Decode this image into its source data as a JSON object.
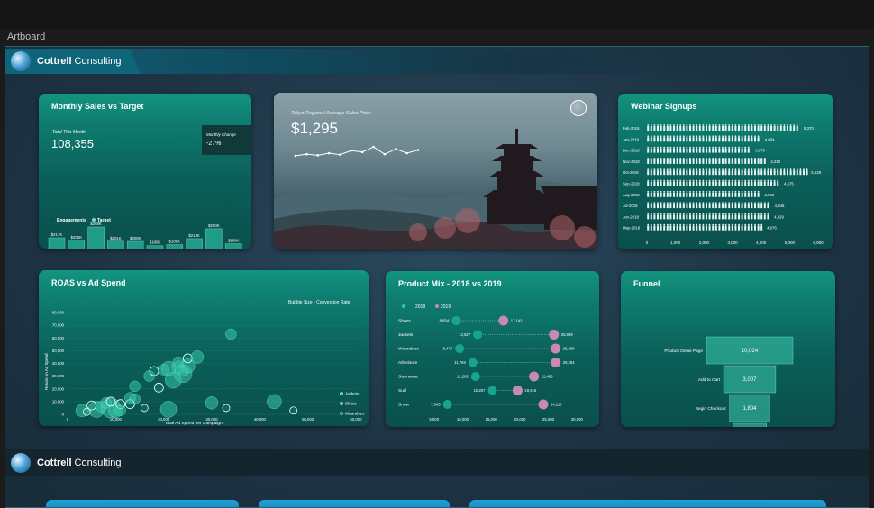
{
  "artboard_label": "Artboard",
  "brand": {
    "bold": "Cottrell",
    "rest": " Consulting"
  },
  "sales": {
    "title": "Monthly Sales vs Target",
    "total_label": "Total This Month",
    "total_value": "108,355",
    "change_label": "Monthly Change",
    "change_value": "-27%",
    "legend": [
      "Engagements",
      "Target"
    ],
    "months": [
      "May-2018",
      "Jun-2018",
      "Jul-2018",
      "Aug-2018",
      "Sep-2018",
      "Oct-2018",
      "Nov-2018",
      "Dec-2018",
      "Jan-2019",
      "Feb-2019"
    ],
    "targets": [
      "$217K",
      "$205K",
      "$268K",
      "$201K",
      "$200K",
      "$180K",
      "$185K",
      "$213K",
      "$260K",
      "$189K"
    ],
    "target_values": [
      217,
      205,
      268,
      201,
      200,
      180,
      185,
      213,
      260,
      189
    ],
    "engagements": [
      "$126K",
      "$108K",
      "$156K",
      "$122K",
      "$117K",
      "$103K",
      "$105K",
      "$124K",
      "$149K",
      "$108K"
    ],
    "engagement_values": [
      126,
      108,
      156,
      122,
      117,
      103,
      105,
      124,
      149,
      108
    ]
  },
  "photo": {
    "subtitle": "Tokyo Regional Average Sales Price",
    "value": "$1,295",
    "trend": [
      0.45,
      0.48,
      0.46,
      0.5,
      0.47,
      0.55,
      0.52,
      0.62,
      0.48,
      0.58,
      0.5,
      0.56
    ]
  },
  "webinar": {
    "title": "Webinar Signups",
    "rows": [
      {
        "m": "Feb-2019",
        "v": 5370,
        "l": "5,370"
      },
      {
        "m": "Jan-2019",
        "v": 4004,
        "l": "4,004"
      },
      {
        "m": "Dec-2018",
        "v": 3670,
        "l": "3,670"
      },
      {
        "m": "Nov-2018",
        "v": 4210,
        "l": "4,210"
      },
      {
        "m": "Oct-2018",
        "v": 5628,
        "l": "5,628"
      },
      {
        "m": "Sep-2018",
        "v": 4675,
        "l": "4,675"
      },
      {
        "m": "Aug-2018",
        "v": 3993,
        "l": "3,993"
      },
      {
        "m": "Jul-2018",
        "v": 4346,
        "l": "4,346"
      },
      {
        "m": "Jun-2018",
        "v": 4329,
        "l": "4,329"
      },
      {
        "m": "May-2018",
        "v": 4076,
        "l": "4,076"
      }
    ],
    "axis": [
      "0",
      "1,000",
      "2,000",
      "3,000",
      "4,000",
      "5,000",
      "6,000"
    ]
  },
  "roas": {
    "title": "ROAS vs Ad Spend",
    "bubble_note": "Bubble Size - Conversion Rate",
    "ylabel": "Return on Ad Spend",
    "xlabel": "Total Ad Spend per Campaign",
    "yticks": [
      "80,000",
      "70,000",
      "60,000",
      "50,000",
      "40,000",
      "30,000",
      "20,000",
      "10,000",
      "0"
    ],
    "xticks": [
      "0",
      "10,000",
      "20,000",
      "30,000",
      "40,000",
      "50,000",
      "60,000"
    ],
    "legend": [
      "Jackets",
      "Shoes",
      "Wearables"
    ],
    "points": [
      [
        3000,
        3000,
        7
      ],
      [
        6000,
        4000,
        9
      ],
      [
        9000,
        5000,
        11
      ],
      [
        10000,
        3000,
        8
      ],
      [
        14000,
        12000,
        6
      ],
      [
        11000,
        8000,
        5
      ],
      [
        21000,
        4000,
        9
      ],
      [
        22000,
        27000,
        9
      ],
      [
        24000,
        32000,
        10
      ],
      [
        23000,
        37000,
        7
      ],
      [
        25000,
        38000,
        8
      ],
      [
        30000,
        9000,
        7
      ],
      [
        33000,
        5000,
        4
      ],
      [
        19000,
        21000,
        5
      ],
      [
        17000,
        30000,
        6
      ],
      [
        34000,
        63000,
        6
      ],
      [
        25000,
        44000,
        5
      ],
      [
        18000,
        34000,
        5
      ],
      [
        13000,
        8000,
        5
      ],
      [
        7000,
        6000,
        6
      ],
      [
        5000,
        7000,
        5
      ],
      [
        4000,
        2000,
        4
      ],
      [
        27000,
        45000,
        7
      ],
      [
        23000,
        41000,
        6
      ],
      [
        21000,
        36000,
        8
      ],
      [
        20000,
        35000,
        6
      ],
      [
        43000,
        10000,
        8
      ],
      [
        8000,
        9000,
        6
      ],
      [
        16000,
        5000,
        4
      ],
      [
        14000,
        22000,
        6
      ],
      [
        13000,
        13000,
        6
      ],
      [
        11000,
        3000,
        6
      ],
      [
        9000,
        10000,
        5
      ],
      [
        47000,
        3000,
        4
      ],
      [
        24000,
        34000,
        6
      ]
    ]
  },
  "mix": {
    "title": "Product Mix - 2018 vs 2019",
    "legend": [
      "2018",
      "2019"
    ],
    "rows": [
      {
        "n": "Shoes",
        "a": 8854,
        "al": "8,854",
        "b": 17142,
        "bl": "17,142"
      },
      {
        "n": "Jackets",
        "a": 12627,
        "al": "12,627",
        "b": 25969,
        "bl": "25,969"
      },
      {
        "n": "Wearables",
        "a": 9476,
        "al": "9,476",
        "b": 26268,
        "bl": "26,268"
      },
      {
        "n": "Athleisure",
        "a": 11793,
        "al": "11,793",
        "b": 26284,
        "bl": "26,284"
      },
      {
        "n": "Swimwear",
        "a": 12262,
        "al": "12,262",
        "b": 22483,
        "bl": "22,483"
      },
      {
        "n": "Surf",
        "a": 15207,
        "al": "15,207",
        "b": 19615,
        "bl": "19,615"
      },
      {
        "n": "Snow",
        "a": 7345,
        "al": "7,345",
        "b": 24118,
        "bl": "24,118"
      }
    ],
    "axis": [
      "5,000",
      "10,000",
      "15,000",
      "20,000",
      "25,000",
      "30,000"
    ]
  },
  "funnel": {
    "title": "Funnel",
    "rows": [
      {
        "n": "Product Detail Page",
        "v": 10024,
        "l": "10,024"
      },
      {
        "n": "Add to Cart",
        "v": 3007,
        "l": "3,007"
      },
      {
        "n": "Begin Checkout",
        "v": 1804,
        "l": "1,804"
      },
      {
        "n": "Purchases",
        "v": 1263,
        "l": "1,263"
      }
    ]
  },
  "colors": {
    "teal": "#12957f",
    "point": "#35c6a7",
    "pink": "#c88bb0"
  }
}
